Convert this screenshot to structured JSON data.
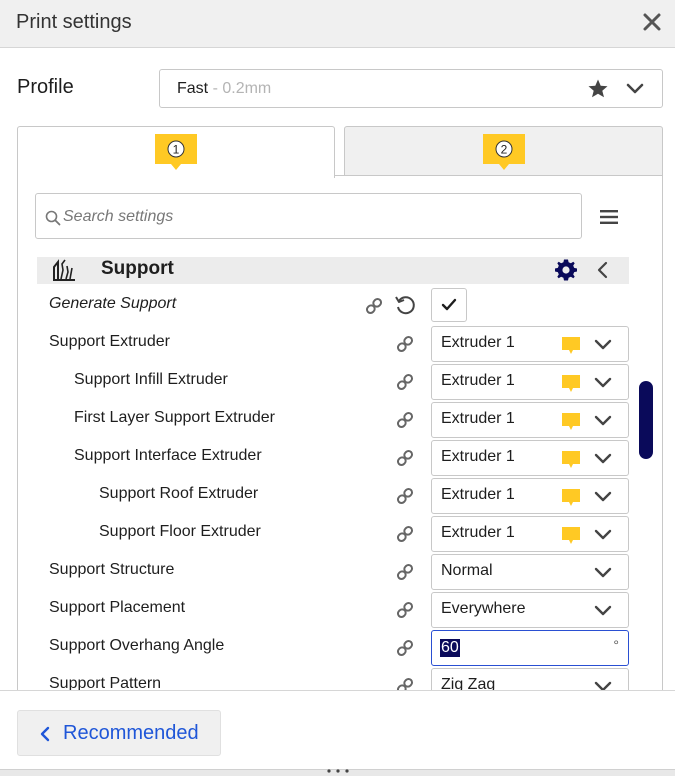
{
  "window": {
    "title": "Print settings"
  },
  "profile": {
    "label": "Profile",
    "name": "Fast",
    "layer": " - 0.2mm"
  },
  "tabs": [
    {
      "badge": "1"
    },
    {
      "badge": "2"
    }
  ],
  "search": {
    "placeholder": "Search settings"
  },
  "category": {
    "title": "Support"
  },
  "settings": {
    "generate_support": {
      "label": "Generate Support",
      "checked": true
    },
    "support_extruder": {
      "label": "Support Extruder",
      "value": "Extruder 1"
    },
    "support_infill_extruder": {
      "label": "Support Infill Extruder",
      "value": "Extruder 1"
    },
    "first_layer_support_extruder": {
      "label": "First Layer Support Extruder",
      "value": "Extruder 1"
    },
    "support_interface_extruder": {
      "label": "Support Interface Extruder",
      "value": "Extruder 1"
    },
    "support_roof_extruder": {
      "label": "Support Roof Extruder",
      "value": "Extruder 1"
    },
    "support_floor_extruder": {
      "label": "Support Floor Extruder",
      "value": "Extruder 1"
    },
    "support_structure": {
      "label": "Support Structure",
      "value": "Normal"
    },
    "support_placement": {
      "label": "Support Placement",
      "value": "Everywhere"
    },
    "support_overhang_angle": {
      "label": "Support Overhang Angle",
      "value": "60",
      "unit": "°"
    },
    "support_pattern": {
      "label": "Support Pattern",
      "value": "Zig Zag"
    }
  },
  "footer": {
    "recommended_label": "Recommended"
  },
  "colors": {
    "accent": "#1f56d8",
    "extruder_badge": "#ffc924",
    "scrollbar": "#0a0a5a",
    "selection": "#0a0a5a"
  }
}
